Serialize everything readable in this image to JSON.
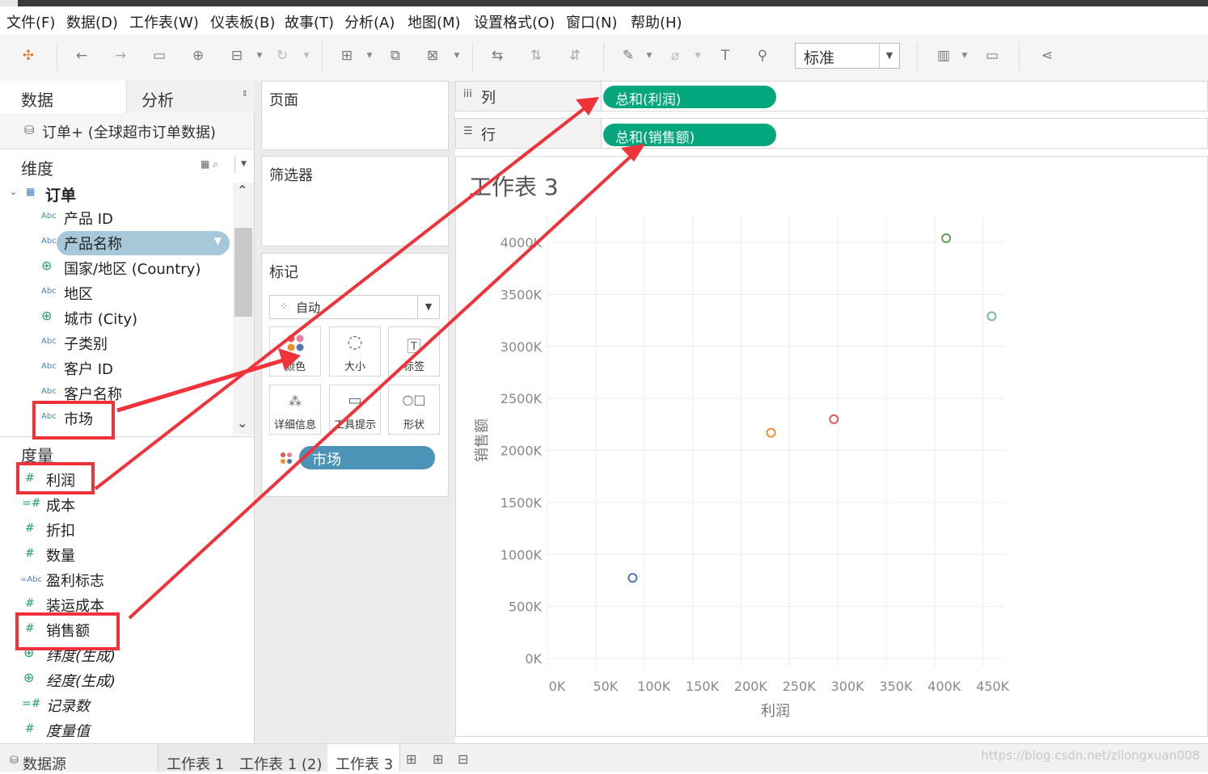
{
  "menu": [
    "文件(F)",
    "数据(D)",
    "工作表(W)",
    "仪表板(B)",
    "故事(T)",
    "分析(A)",
    "地图(M)",
    "设置格式(O)",
    "窗口(N)",
    "帮助(H)"
  ],
  "toolbar": {
    "icons": [
      "tableau-logo-icon",
      "undo-icon",
      "redo-icon",
      "save-icon",
      "new-datasource-icon",
      "pause-datasource-icon",
      "refresh-icon",
      "new-worksheet-icon",
      "duplicate-sheet-icon",
      "clear-sheet-icon",
      "swap-axes-icon",
      "sort-ascending-icon",
      "sort-descending-icon",
      "highlight-icon",
      "group-icon",
      "show-labels-icon",
      "pin-axis-icon",
      "show-me-icon",
      "presentation-icon",
      "share-icon"
    ],
    "fit_value": "标准"
  },
  "data_pane": {
    "tab_data": "数据",
    "tab_analysis": "分析",
    "datasource": "订单+ (全球超市订单数据)",
    "dimensions_header": "维度",
    "order_table": "订单",
    "dimensions": [
      {
        "icon": "Abc",
        "label": "产品 ID"
      },
      {
        "icon": "Abc",
        "label": "产品名称",
        "selected": true
      },
      {
        "icon": "globe",
        "label": "国家/地区 (Country)"
      },
      {
        "icon": "Abc",
        "label": "地区"
      },
      {
        "icon": "globe",
        "label": "城市 (City)"
      },
      {
        "icon": "Abc",
        "label": "子类别"
      },
      {
        "icon": "Abc",
        "label": "客户 ID"
      },
      {
        "icon": "Abc",
        "label": "客户名称"
      },
      {
        "icon": "Abc",
        "label": "市场"
      }
    ],
    "measures_header": "度量",
    "measures": [
      {
        "icon": "#",
        "label": "利润"
      },
      {
        "icon": "=#",
        "label": "成本"
      },
      {
        "icon": "#",
        "label": "折扣"
      },
      {
        "icon": "#",
        "label": "数量"
      },
      {
        "icon": "=Abc",
        "label": "盈利标志"
      },
      {
        "icon": "#",
        "label": "装运成本"
      },
      {
        "icon": "#",
        "label": "销售额"
      },
      {
        "icon": "globe",
        "label": "纬度(生成)"
      },
      {
        "icon": "globe",
        "label": "经度(生成)"
      },
      {
        "icon": "=#",
        "label": "记录数"
      },
      {
        "icon": "#",
        "label": "度量值"
      }
    ]
  },
  "cards": {
    "pages": "页面",
    "filters": "筛选器",
    "marks": "标记",
    "mark_type": "自动",
    "mark_buttons": [
      "颜色",
      "大小",
      "标签",
      "详细信息",
      "工具提示",
      "形状"
    ],
    "color_pill": "市场"
  },
  "shelves": {
    "columns_label": "列",
    "rows_label": "行",
    "columns_pill": "总和(利润)",
    "rows_pill": "总和(销售额)"
  },
  "sheet_title": "工作表 3",
  "chart_data": {
    "type": "scatter",
    "title": "工作表 3",
    "xlabel": "利润",
    "ylabel": "销售额",
    "x_ticks": [
      "0K",
      "50K",
      "100K",
      "150K",
      "200K",
      "250K",
      "300K",
      "350K",
      "400K",
      "450K"
    ],
    "y_ticks": [
      "0K",
      "500K",
      "1000K",
      "1500K",
      "2000K",
      "2500K",
      "3000K",
      "3500K",
      "4000K"
    ],
    "xlim": [
      0,
      450000
    ],
    "ylim": [
      0,
      4000000
    ],
    "grid": true,
    "points": [
      {
        "x": 78000,
        "y": 775000,
        "color": "#4e79a7"
      },
      {
        "x": 221000,
        "y": 2170000,
        "color": "#f28e2b"
      },
      {
        "x": 286000,
        "y": 2300000,
        "color": "#e15759"
      },
      {
        "x": 402000,
        "y": 4040000,
        "color": "#59a14f"
      },
      {
        "x": 449000,
        "y": 3290000,
        "color": "#76b7b2"
      }
    ]
  },
  "bottom_tabs": [
    "数据源",
    "工作表 1",
    "工作表 1 (2)",
    "工作表 3"
  ],
  "bottom_tab_icons": [
    "new-worksheet-icon",
    "new-dashboard-icon",
    "new-story-icon"
  ],
  "watermark": "https://blog.csdn.net/zilongxuan008",
  "colors": {
    "pill_green": "#04a67d",
    "pill_blue": "#4c94b7",
    "annotation_red": "#f0323a"
  }
}
